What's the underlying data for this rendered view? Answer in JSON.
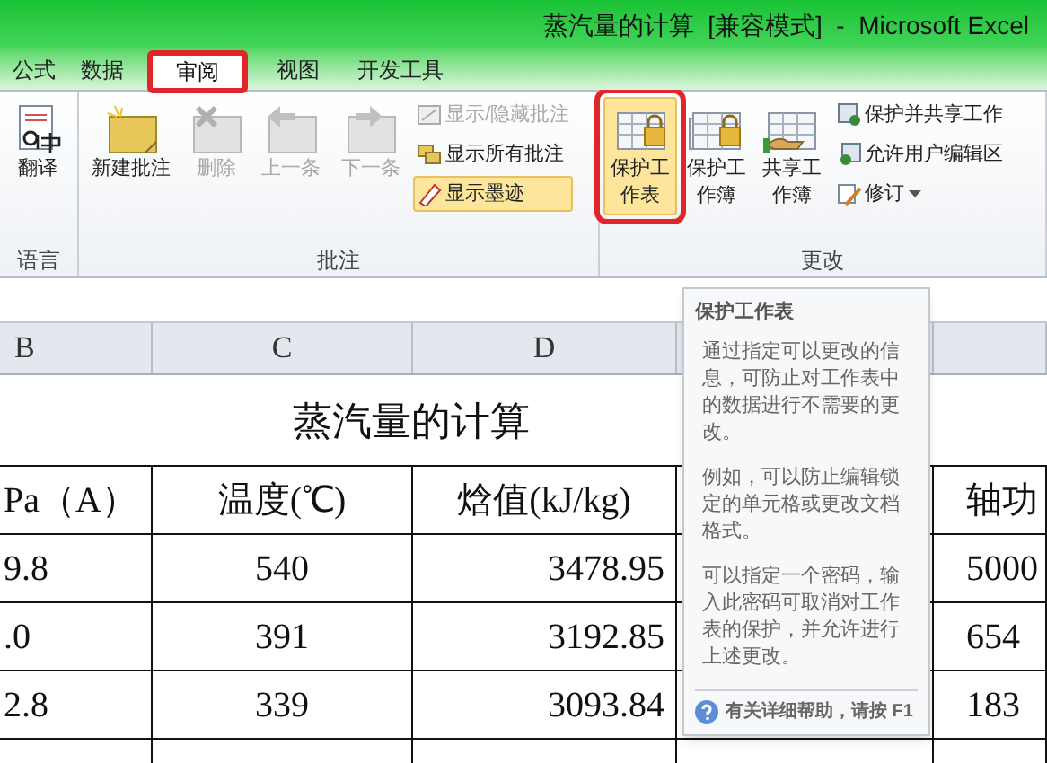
{
  "window": {
    "title": "蒸汽量的计算  [兼容模式]  -  Microsoft Excel"
  },
  "tabs": [
    {
      "label": "公式",
      "selected": false
    },
    {
      "label": "数据",
      "selected": false
    },
    {
      "label": "审阅",
      "selected": true
    },
    {
      "label": "视图",
      "selected": false
    },
    {
      "label": "开发工具",
      "selected": false
    }
  ],
  "ribbon_groups": [
    {
      "label": "语言",
      "large_buttons": [
        {
          "label": "翻译",
          "kind": "translate",
          "disabled": false,
          "highlighted": false
        }
      ]
    },
    {
      "label": "批注",
      "large_buttons": [
        {
          "label": "新建批注",
          "kind": "note-new",
          "disabled": false,
          "highlighted": false
        },
        {
          "label": "删除",
          "kind": "note-delete",
          "disabled": true,
          "highlighted": false
        },
        {
          "label": "上一条",
          "kind": "note-prev",
          "disabled": true,
          "highlighted": false
        },
        {
          "label": "下一条",
          "kind": "note-next",
          "disabled": true,
          "highlighted": false
        }
      ],
      "small_buttons": [
        {
          "label": "显示/隐藏批注",
          "kind": "note-toggle",
          "disabled": true,
          "highlighted": false,
          "dropdown": false
        },
        {
          "label": "显示所有批注",
          "kind": "notes-all",
          "disabled": false,
          "highlighted": false,
          "dropdown": false
        },
        {
          "label": "显示墨迹",
          "kind": "ink",
          "disabled": false,
          "highlighted": true,
          "dropdown": false
        }
      ]
    },
    {
      "label": "更改",
      "large_buttons": [
        {
          "label": "保护工作表",
          "kind": "protect-sheet",
          "disabled": false,
          "highlighted": true
        },
        {
          "label": "保护工作簿",
          "kind": "protect-book",
          "disabled": false,
          "highlighted": false
        },
        {
          "label": "共享工作簿",
          "kind": "share-book",
          "disabled": false,
          "highlighted": false
        }
      ],
      "small_buttons": [
        {
          "label": "保护并共享工作",
          "kind": "protect-share",
          "disabled": false,
          "highlighted": false,
          "dropdown": false
        },
        {
          "label": "允许用户编辑区",
          "kind": "allow-edit",
          "disabled": false,
          "highlighted": false,
          "dropdown": false
        },
        {
          "label": "修订",
          "kind": "track",
          "disabled": false,
          "highlighted": false,
          "dropdown": true
        }
      ]
    }
  ],
  "column_headers": [
    "B",
    "C",
    "D"
  ],
  "sheet_title": "蒸汽量的计算",
  "rows": [
    {
      "column_b": "Pa（A）",
      "column_c": "温度(℃)",
      "column_d": "焓值(kJ/kg)",
      "column_f": "轴功"
    },
    {
      "column_b": "9.8",
      "column_c": "540",
      "column_d": "3478.95",
      "column_f": "5000"
    },
    {
      "column_b": ".0",
      "column_c": "391",
      "column_d": "3192.85",
      "column_f": "654"
    },
    {
      "column_b": "2.8",
      "column_c": "339",
      "column_d": "3093.84",
      "column_f": "183"
    }
  ],
  "tooltip": {
    "title": "保护工作表",
    "paragraphs": [
      "通过指定可以更改的信息，可防止对工作表中的数据进行不需要的更改。",
      "例如，可以防止编辑锁定的单元格或更改文档格式。",
      "可以指定一个密码，输入此密码可取消对工作表的保护，并允许进行上述更改。"
    ],
    "help": "有关详细帮助，请按 F1"
  }
}
